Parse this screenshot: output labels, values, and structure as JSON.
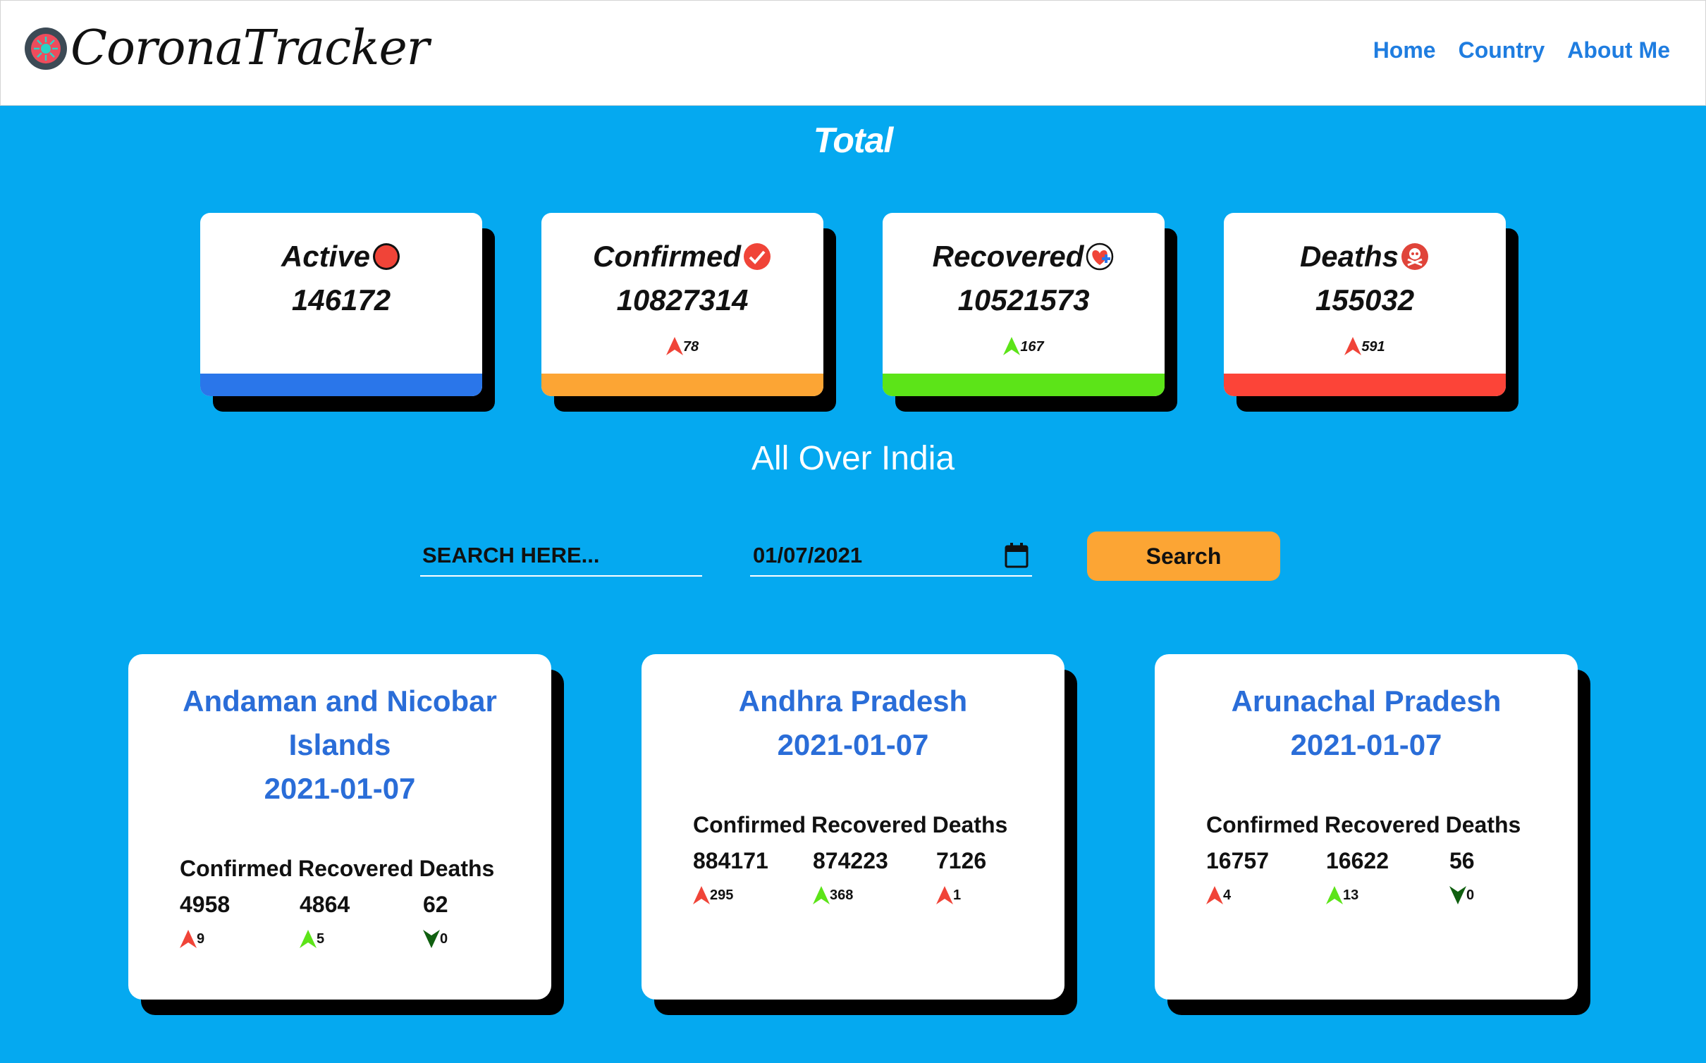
{
  "header": {
    "brand": "CoronaTracker",
    "nav": [
      {
        "label": "Home"
      },
      {
        "label": "Country"
      },
      {
        "label": "About Me"
      }
    ]
  },
  "total": {
    "title": "Total",
    "cards": [
      {
        "label": "Active",
        "value": "146172",
        "delta": "",
        "bar_color": "#2a76ea",
        "icon": "red-dot-icon"
      },
      {
        "label": "Confirmed",
        "value": "10827314",
        "delta": "78",
        "delta_dir": "up",
        "bar_color": "#fca534",
        "icon": "check-circle-icon"
      },
      {
        "label": "Recovered",
        "value": "10521573",
        "delta": "167",
        "delta_dir": "up",
        "bar_color": "#5ce418",
        "icon": "heart-plus-icon"
      },
      {
        "label": "Deaths",
        "value": "155032",
        "delta": "591",
        "delta_dir": "up",
        "bar_color": "#fc4438",
        "icon": "skull-icon"
      }
    ]
  },
  "subtitle": "All Over India",
  "search": {
    "placeholder": "SEARCH HERE...",
    "date_value": "01/07/2021",
    "button_label": "Search"
  },
  "states": [
    {
      "name": "Andaman and Nicobar Islands",
      "date": "2021-01-07",
      "headers": {
        "confirmed": "Confirmed",
        "recovered": "Recovered",
        "deaths": "Deaths"
      },
      "confirmed": "4958",
      "recovered": "4864",
      "deaths": "62",
      "confirmed_delta": "9",
      "recovered_delta": "5",
      "deaths_delta": "0",
      "deaths_dir": "down"
    },
    {
      "name": "Andhra Pradesh",
      "date": "2021-01-07",
      "headers": {
        "confirmed": "Confirmed",
        "recovered": "Recovered",
        "deaths": "Deaths"
      },
      "confirmed": "884171",
      "recovered": "874223",
      "deaths": "7126",
      "confirmed_delta": "295",
      "recovered_delta": "368",
      "deaths_delta": "1",
      "deaths_dir": "up"
    },
    {
      "name": "Arunachal Pradesh",
      "date": "2021-01-07",
      "headers": {
        "confirmed": "Confirmed",
        "recovered": "Recovered",
        "deaths": "Deaths"
      },
      "confirmed": "16757",
      "recovered": "16622",
      "deaths": "56",
      "confirmed_delta": "4",
      "recovered_delta": "13",
      "deaths_delta": "0",
      "deaths_dir": "down"
    }
  ],
  "colors": {
    "background": "#05a9f0",
    "link": "#1f7de0",
    "state_title": "#2a6dd8",
    "up_red": "#f04438",
    "up_green": "#5ce418",
    "down_dark_green": "#0f5f0f"
  }
}
